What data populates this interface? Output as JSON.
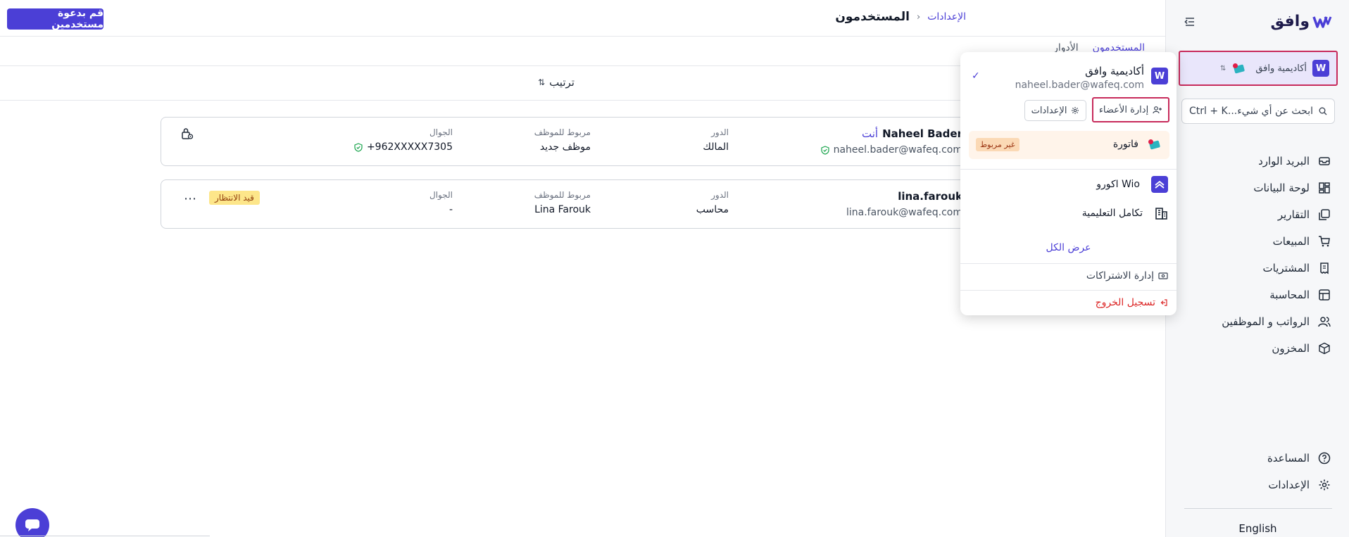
{
  "app": {
    "logo_text": "وافق"
  },
  "sidebar": {
    "org": {
      "name": "أكاديمية وافق",
      "logo_letter": "W"
    },
    "search": {
      "placeholder": "ابحث عن أي شيء...",
      "shortcut": "Ctrl + K"
    },
    "items": [
      {
        "label": "البريد الوارد",
        "icon": "inbox-icon"
      },
      {
        "label": "لوحة البيانات",
        "icon": "dashboard-icon"
      },
      {
        "label": "التقارير",
        "icon": "reports-icon"
      },
      {
        "label": "المبيعات",
        "icon": "cart-icon"
      },
      {
        "label": "المشتريات",
        "icon": "receipt-icon"
      },
      {
        "label": "المحاسبة",
        "icon": "ledger-icon"
      },
      {
        "label": "الرواتب و الموظفين",
        "icon": "users-icon"
      },
      {
        "label": "المخزون",
        "icon": "box-icon"
      }
    ],
    "bottom_items": [
      {
        "label": "المساعدة",
        "icon": "help-icon"
      },
      {
        "label": "الإعدادات",
        "icon": "gear-icon"
      }
    ],
    "language": "English"
  },
  "header": {
    "breadcrumb_parent": "الإعدادات",
    "breadcrumb_current": "المستخدمون",
    "invite_button": "قم بدعوة مستخدمين"
  },
  "tabs": {
    "users": "المستخدمون",
    "roles": "الأدوار"
  },
  "toolbar": {
    "sort_label": "ترتيب"
  },
  "users": [
    {
      "name": "Naheel Bader",
      "you_tag": "أنت",
      "email": "naheel.bader@wafeq.com",
      "role_label": "الدور",
      "role": "المالك",
      "employee_label": "مربوط للموظف",
      "employee": "موظف جديد",
      "phone_label": "الجوال",
      "phone": "+962XXXXX7305"
    },
    {
      "name": "lina.farouk",
      "email": "lina.farouk@wafeq.com",
      "role_label": "الدور",
      "role": "محاسب",
      "employee_label": "مربوط للموظف",
      "employee": "Lina Farouk",
      "phone_label": "الجوال",
      "phone": "-",
      "status": "قيد الانتظار"
    }
  ],
  "dropdown": {
    "current_org": {
      "name": "أكاديمية وافق",
      "email": "naheel.bader@wafeq.com"
    },
    "manage_members": "إدارة الأعضاء",
    "settings": "الإعدادات",
    "linked_app": {
      "name": "فاتورة",
      "status": "غير مربوط"
    },
    "other_orgs": [
      "Wio اكورو",
      "تكامل التعليمية"
    ],
    "show_all": "عرض الكل",
    "manage_subscriptions": "إدارة الاشتراكات",
    "logout": "تسجيل الخروج"
  },
  "colors": {
    "accent": "#4b3fd6",
    "highlight": "#c72a5b",
    "danger": "#dc2626"
  }
}
